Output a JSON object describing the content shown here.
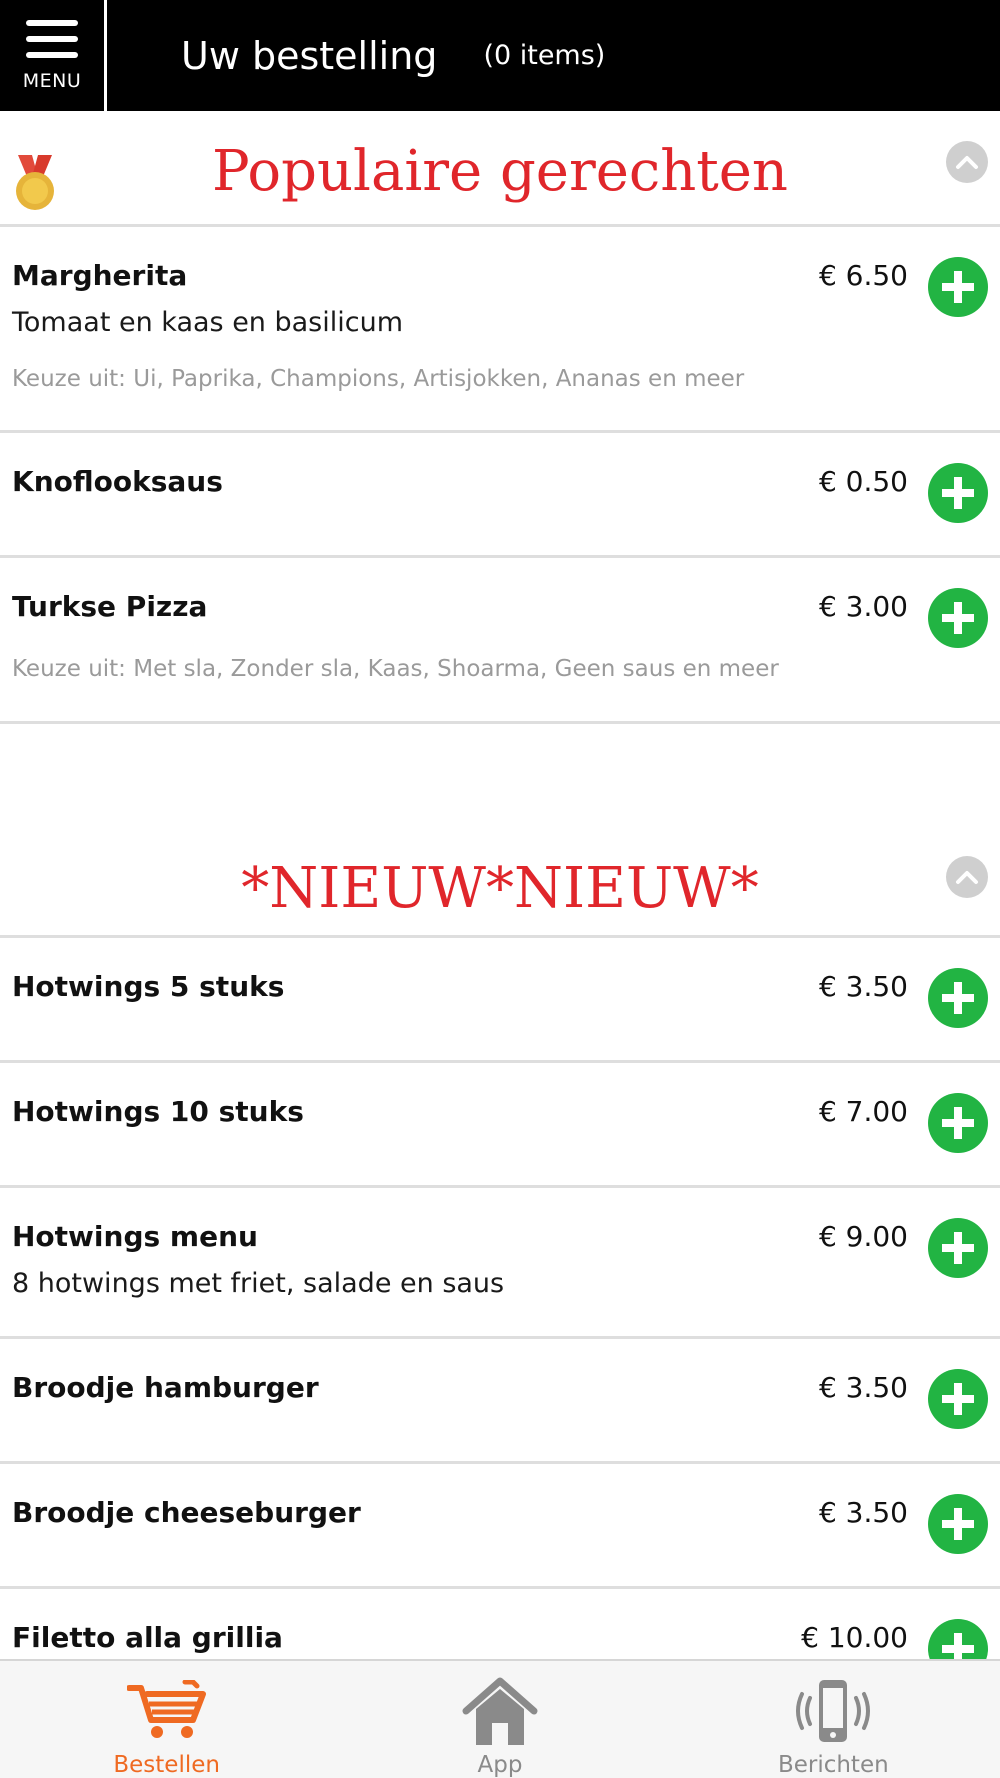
{
  "header": {
    "menu_label": "MENU",
    "title": "Uw bestelling",
    "count": "(0 items)"
  },
  "sections": [
    {
      "title": "Populaire gerechten",
      "items": [
        {
          "name": "Margherita",
          "price": "€ 6.50",
          "description": "Tomaat en kaas en basilicum",
          "choices": "Keuze uit: Ui, Paprika, Champions, Artisjokken, Ananas en meer"
        },
        {
          "name": "Knoflooksaus",
          "price": "€ 0.50"
        },
        {
          "name": "Turkse Pizza",
          "price": "€ 3.00",
          "choices": "Keuze uit: Met sla, Zonder sla, Kaas, Shoarma, Geen saus en meer"
        }
      ]
    },
    {
      "title": "*NIEUW*NIEUW*",
      "items": [
        {
          "name": "Hotwings 5 stuks",
          "price": "€ 3.50"
        },
        {
          "name": "Hotwings 10 stuks",
          "price": "€ 7.00"
        },
        {
          "name": "Hotwings menu",
          "price": "€ 9.00",
          "description": "8 hotwings met friet, salade en saus"
        },
        {
          "name": "Broodje hamburger",
          "price": "€ 3.50"
        },
        {
          "name": "Broodje cheeseburger",
          "price": "€ 3.50"
        },
        {
          "name": "Filetto alla grillia",
          "price": "€ 10.00"
        }
      ]
    }
  ],
  "tabbar": {
    "tabs": [
      {
        "label": "Bestellen",
        "icon": "cart-icon"
      },
      {
        "label": "App",
        "icon": "home-icon"
      },
      {
        "label": "Berichten",
        "icon": "phone-vibrate-icon"
      }
    ]
  },
  "colors": {
    "accent_red": "#e0262b",
    "add_green": "#22b443",
    "active_tab": "#ef6a22",
    "inactive_tab": "#8a8a8a"
  }
}
